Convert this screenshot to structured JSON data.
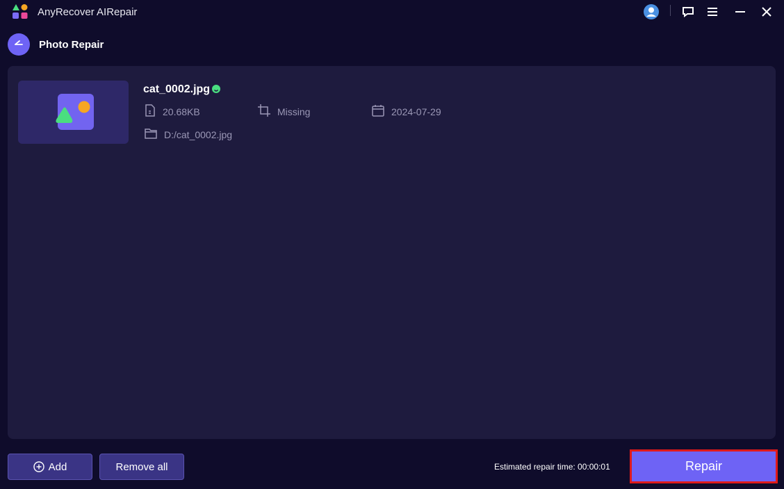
{
  "app": {
    "title": "AnyRecover AIRepair"
  },
  "header": {
    "title": "Photo Repair"
  },
  "file": {
    "name": "cat_0002.jpg",
    "size": "20.68KB",
    "resolution": "Missing",
    "date": "2024-07-29",
    "path": "D:/cat_0002.jpg"
  },
  "footer": {
    "add_label": "Add",
    "remove_all_label": "Remove all",
    "estimated_time": "Estimated repair time: 00:00:01",
    "repair_label": "Repair"
  },
  "icons": {
    "logo": "anyrecover-logo-icon",
    "user": "user-account-icon",
    "feedback": "feedback-icon",
    "menu": "menu-icon",
    "minimize": "minimize-icon",
    "close": "close-icon",
    "back": "back-arrow-icon",
    "status": "status-ok-icon",
    "size": "file-size-icon",
    "resolution": "crop-icon",
    "date": "calendar-icon",
    "path": "folder-icon",
    "add": "plus-circle-icon"
  },
  "colors": {
    "background": "#0f0c2b",
    "panel": "#1e1b3e",
    "accent": "#6e63f5",
    "status_ok": "#4ade80",
    "highlight_border": "#e01a1a"
  }
}
